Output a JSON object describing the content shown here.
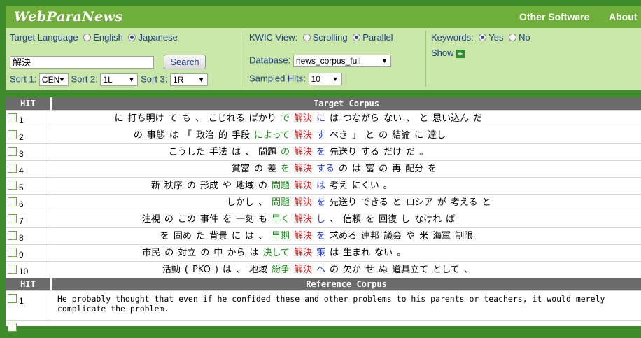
{
  "header": {
    "logo": "WebParaNews",
    "nav": [
      "Other Software",
      "About"
    ]
  },
  "controls": {
    "target_language": {
      "label": "Target Language",
      "options": [
        "English",
        "Japanese"
      ],
      "selected": "Japanese"
    },
    "search": {
      "value": "解決",
      "button": "Search"
    },
    "sorts": [
      {
        "label": "Sort 1:",
        "value": "CEN"
      },
      {
        "label": "Sort 2:",
        "value": "1L"
      },
      {
        "label": "Sort 3:",
        "value": "1R"
      }
    ],
    "kwic_view": {
      "label": "KWIC View:",
      "options": [
        "Scrolling",
        "Parallel"
      ],
      "selected": "Parallel"
    },
    "database": {
      "label": "Database:",
      "value": "news_corpus_full"
    },
    "sampled_hits": {
      "label": "Sampled Hits:",
      "value": "10"
    },
    "keywords": {
      "label": "Keywords:",
      "options": [
        "Yes",
        "No"
      ],
      "selected": "Yes"
    },
    "show": {
      "label": "Show",
      "icon": "plus-icon"
    }
  },
  "colors": {
    "frame": "#3e8c2c",
    "header": "#6fae39",
    "controls_bg": "#c9e7a8",
    "table_header": "#6b6b6b",
    "keyword_red": "#e01e1e",
    "collocate_green": "#1e8e1e",
    "collocate_blue": "#1e3cd8"
  },
  "target_header": {
    "hit": "HIT",
    "title": "Target Corpus"
  },
  "reference_header": {
    "hit": "HIT",
    "title": "Reference Corpus"
  },
  "target_rows": [
    {
      "num": "1",
      "left": [
        {
          "t": "に",
          "c": ""
        },
        {
          "t": "打ち明け",
          "c": ""
        },
        {
          "t": "て",
          "c": ""
        },
        {
          "t": "も",
          "c": ""
        },
        {
          "t": "、",
          "c": ""
        },
        {
          "t": "こじれる",
          "c": ""
        },
        {
          "t": "ばかり",
          "c": ""
        },
        {
          "t": "で",
          "c": "green"
        }
      ],
      "key": "解決",
      "right": [
        {
          "t": "に",
          "c": "blue"
        },
        {
          "t": "は",
          "c": ""
        },
        {
          "t": "つながら",
          "c": ""
        },
        {
          "t": "ない",
          "c": ""
        },
        {
          "t": "、",
          "c": ""
        },
        {
          "t": "と",
          "c": ""
        },
        {
          "t": "思い込ん",
          "c": ""
        },
        {
          "t": "だ",
          "c": ""
        }
      ]
    },
    {
      "num": "2",
      "left": [
        {
          "t": "の",
          "c": ""
        },
        {
          "t": "事態",
          "c": ""
        },
        {
          "t": "は",
          "c": ""
        },
        {
          "t": "「",
          "c": ""
        },
        {
          "t": "政治",
          "c": ""
        },
        {
          "t": "的",
          "c": ""
        },
        {
          "t": "手段",
          "c": ""
        },
        {
          "t": "によって",
          "c": "green"
        }
      ],
      "key": "解決",
      "right": [
        {
          "t": "す",
          "c": "blue"
        },
        {
          "t": "べき",
          "c": ""
        },
        {
          "t": "」",
          "c": ""
        },
        {
          "t": "と",
          "c": ""
        },
        {
          "t": "の",
          "c": ""
        },
        {
          "t": "結論",
          "c": ""
        },
        {
          "t": "に",
          "c": ""
        },
        {
          "t": "達し",
          "c": ""
        }
      ]
    },
    {
      "num": "3",
      "left": [
        {
          "t": "こうした",
          "c": ""
        },
        {
          "t": "手法",
          "c": ""
        },
        {
          "t": "は",
          "c": ""
        },
        {
          "t": "、",
          "c": ""
        },
        {
          "t": "問題",
          "c": ""
        },
        {
          "t": "の",
          "c": "green"
        }
      ],
      "key": "解決",
      "right": [
        {
          "t": "を",
          "c": "blue"
        },
        {
          "t": "先送り",
          "c": ""
        },
        {
          "t": "する",
          "c": ""
        },
        {
          "t": "だけ",
          "c": ""
        },
        {
          "t": "だ",
          "c": ""
        },
        {
          "t": "。",
          "c": ""
        }
      ]
    },
    {
      "num": "4",
      "left": [
        {
          "t": "貧富",
          "c": ""
        },
        {
          "t": "の",
          "c": ""
        },
        {
          "t": "差",
          "c": ""
        },
        {
          "t": "を",
          "c": "green"
        }
      ],
      "key": "解決",
      "right": [
        {
          "t": "する",
          "c": "blue"
        },
        {
          "t": "の",
          "c": ""
        },
        {
          "t": "は",
          "c": ""
        },
        {
          "t": "富",
          "c": ""
        },
        {
          "t": "の",
          "c": ""
        },
        {
          "t": "再",
          "c": ""
        },
        {
          "t": "配分",
          "c": ""
        },
        {
          "t": "を",
          "c": ""
        }
      ]
    },
    {
      "num": "5",
      "left": [
        {
          "t": "新",
          "c": ""
        },
        {
          "t": "秩序",
          "c": ""
        },
        {
          "t": "の",
          "c": ""
        },
        {
          "t": "形成",
          "c": ""
        },
        {
          "t": "や",
          "c": ""
        },
        {
          "t": "地域",
          "c": ""
        },
        {
          "t": "の",
          "c": ""
        },
        {
          "t": "問題",
          "c": "green"
        }
      ],
      "key": "解決",
      "right": [
        {
          "t": "は",
          "c": "blue"
        },
        {
          "t": "考え",
          "c": ""
        },
        {
          "t": "にくい",
          "c": ""
        },
        {
          "t": "。",
          "c": ""
        }
      ]
    },
    {
      "num": "6",
      "left": [
        {
          "t": "しかし",
          "c": ""
        },
        {
          "t": "、",
          "c": ""
        },
        {
          "t": "問題",
          "c": "green"
        }
      ],
      "key": "解決",
      "right": [
        {
          "t": "を",
          "c": "blue"
        },
        {
          "t": "先送り",
          "c": ""
        },
        {
          "t": "できる",
          "c": ""
        },
        {
          "t": "と",
          "c": ""
        },
        {
          "t": "ロシア",
          "c": ""
        },
        {
          "t": "が",
          "c": ""
        },
        {
          "t": "考える",
          "c": ""
        },
        {
          "t": "と",
          "c": ""
        }
      ]
    },
    {
      "num": "7",
      "left": [
        {
          "t": "注視",
          "c": ""
        },
        {
          "t": "の",
          "c": ""
        },
        {
          "t": "この",
          "c": ""
        },
        {
          "t": "事件",
          "c": ""
        },
        {
          "t": "を",
          "c": ""
        },
        {
          "t": "一刻",
          "c": ""
        },
        {
          "t": "も",
          "c": ""
        },
        {
          "t": "早く",
          "c": "green"
        }
      ],
      "key": "解決",
      "right": [
        {
          "t": "し",
          "c": "blue"
        },
        {
          "t": "、",
          "c": ""
        },
        {
          "t": "信頼",
          "c": ""
        },
        {
          "t": "を",
          "c": ""
        },
        {
          "t": "回復",
          "c": ""
        },
        {
          "t": "し",
          "c": ""
        },
        {
          "t": "なけれ",
          "c": ""
        },
        {
          "t": "ば",
          "c": ""
        }
      ]
    },
    {
      "num": "8",
      "left": [
        {
          "t": "を",
          "c": ""
        },
        {
          "t": "固め",
          "c": ""
        },
        {
          "t": "た",
          "c": ""
        },
        {
          "t": "背景",
          "c": ""
        },
        {
          "t": "に",
          "c": ""
        },
        {
          "t": "は",
          "c": ""
        },
        {
          "t": "、",
          "c": ""
        },
        {
          "t": "早期",
          "c": "green"
        }
      ],
      "key": "解決",
      "right": [
        {
          "t": "を",
          "c": "blue"
        },
        {
          "t": "求める",
          "c": ""
        },
        {
          "t": "連邦",
          "c": ""
        },
        {
          "t": "議会",
          "c": ""
        },
        {
          "t": "や",
          "c": ""
        },
        {
          "t": "米",
          "c": ""
        },
        {
          "t": "海軍",
          "c": ""
        },
        {
          "t": "制限",
          "c": ""
        }
      ]
    },
    {
      "num": "9",
      "left": [
        {
          "t": "市民",
          "c": ""
        },
        {
          "t": "の",
          "c": ""
        },
        {
          "t": "対立",
          "c": ""
        },
        {
          "t": "の",
          "c": ""
        },
        {
          "t": "中",
          "c": ""
        },
        {
          "t": "から",
          "c": ""
        },
        {
          "t": "は",
          "c": ""
        },
        {
          "t": "決して",
          "c": "green"
        }
      ],
      "key": "解決",
      "right": [
        {
          "t": "策",
          "c": "blue"
        },
        {
          "t": "は",
          "c": ""
        },
        {
          "t": "生まれ",
          "c": ""
        },
        {
          "t": "ない",
          "c": ""
        },
        {
          "t": "。",
          "c": ""
        }
      ]
    },
    {
      "num": "10",
      "left": [
        {
          "t": "活動",
          "c": ""
        },
        {
          "t": "(",
          "c": ""
        },
        {
          "t": "PKO",
          "c": ""
        },
        {
          "t": ")",
          "c": ""
        },
        {
          "t": "は",
          "c": ""
        },
        {
          "t": "、",
          "c": ""
        },
        {
          "t": "地域",
          "c": ""
        },
        {
          "t": "紛争",
          "c": "green"
        }
      ],
      "key": "解決",
      "right": [
        {
          "t": "へ",
          "c": "blue"
        },
        {
          "t": "の",
          "c": ""
        },
        {
          "t": "欠か",
          "c": ""
        },
        {
          "t": "せ",
          "c": ""
        },
        {
          "t": "ぬ",
          "c": ""
        },
        {
          "t": "道具立て",
          "c": ""
        },
        {
          "t": "として",
          "c": ""
        },
        {
          "t": "、",
          "c": ""
        }
      ]
    }
  ],
  "reference_rows": [
    {
      "num": "1",
      "text": "He probably thought that even if he confided these and other problems to his parents or teachers, it would merely complicate the problem."
    }
  ]
}
